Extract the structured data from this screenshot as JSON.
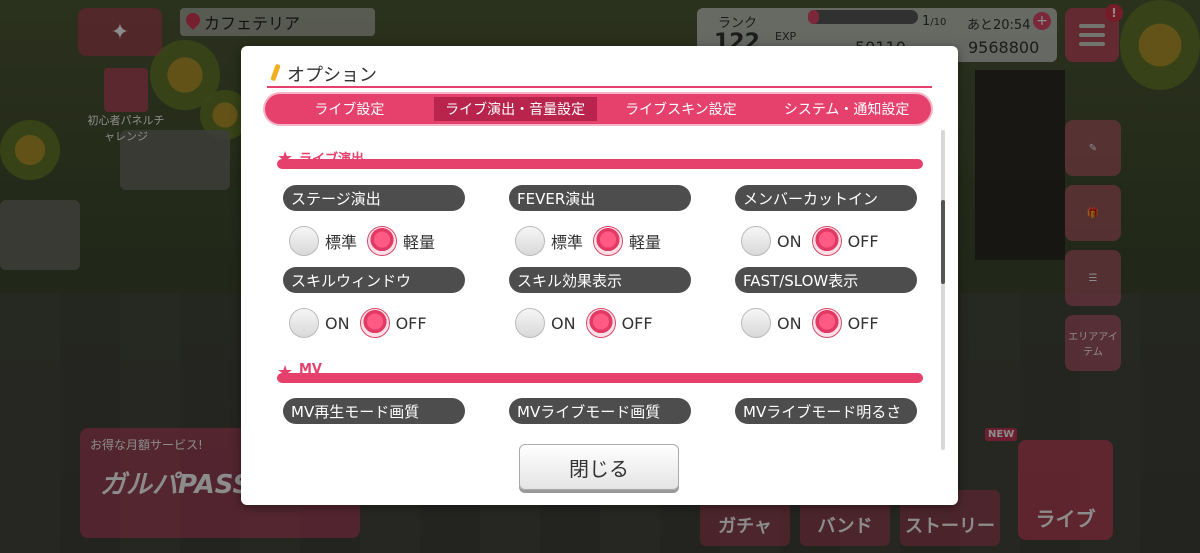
{
  "hud": {
    "location": "カフェテリア",
    "rank_label": "ランク",
    "rank_value": "122",
    "exp_label": "EXP",
    "stamina_fraction": 0.1,
    "stamina_current": "1",
    "stamina_max": "/10",
    "stamina_timer": "あと20:54",
    "stars": "50110",
    "coins": "9568800",
    "notification_badge": "!",
    "panel_challenge": "初心者パネルチャレンジ",
    "area_item": "エリアアイテム",
    "promo_title": "お得な月額サービス!",
    "promo_logo": "ガルパPASS",
    "nav_gacha": "ガチャ",
    "nav_band": "バンド",
    "nav_story": "ストーリー",
    "nav_live": "ライブ",
    "new_tag": "NEW"
  },
  "modal": {
    "title": "オプション",
    "tabs": [
      {
        "label": "ライブ設定",
        "active": false
      },
      {
        "label": "ライブ演出・音量設定",
        "active": true
      },
      {
        "label": "ライブスキン設定",
        "active": false
      },
      {
        "label": "システム・通知設定",
        "active": false
      }
    ],
    "sections": [
      {
        "label": "ライブ演出",
        "options": [
          {
            "label": "ステージ演出",
            "choices": [
              "標準",
              "軽量"
            ],
            "selected": 1
          },
          {
            "label": "FEVER演出",
            "choices": [
              "標準",
              "軽量"
            ],
            "selected": 1
          },
          {
            "label": "メンバーカットイン",
            "choices": [
              "ON",
              "OFF"
            ],
            "selected": 1
          },
          {
            "label": "スキルウィンドウ",
            "choices": [
              "ON",
              "OFF"
            ],
            "selected": 1
          },
          {
            "label": "スキル効果表示",
            "choices": [
              "ON",
              "OFF"
            ],
            "selected": 1
          },
          {
            "label": "FAST/SLOW表示",
            "choices": [
              "ON",
              "OFF"
            ],
            "selected": 1
          }
        ]
      },
      {
        "label": "MV",
        "options": [
          {
            "label": "MV再生モード画質"
          },
          {
            "label": "MVライブモード画質"
          },
          {
            "label": "MVライブモード明るさ"
          }
        ]
      }
    ],
    "close_label": "閉じる"
  }
}
